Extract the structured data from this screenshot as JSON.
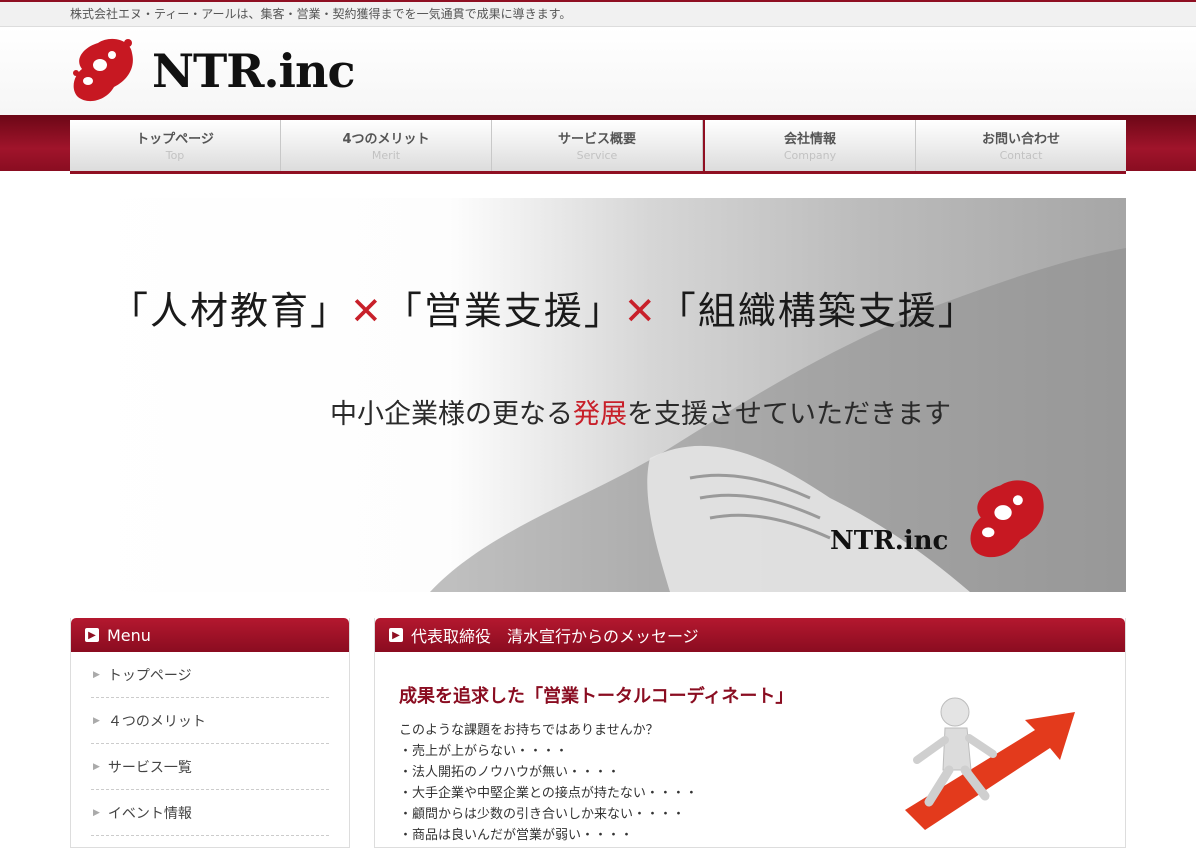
{
  "topbar": {
    "tagline": "株式会社エヌ・ティー・アールは、集客・営業・契約獲得までを一気通貫で成果に導きます。"
  },
  "header": {
    "logo_text": "NTR.inc",
    "logo_icon": "ntr-logo-mark"
  },
  "nav": [
    {
      "jp": "トップページ",
      "en": "Top"
    },
    {
      "jp": "4つのメリット",
      "en": "Merit"
    },
    {
      "jp": "サービス概要",
      "en": "Service"
    },
    {
      "jp": "会社情報",
      "en": "Company"
    },
    {
      "jp": "お問い合わせ",
      "en": "Contact"
    }
  ],
  "hero": {
    "t1": "「人材教育」",
    "x": "✕",
    "t2": "「営業支援」",
    "t3": "「組織構築支援」",
    "sub_a": "中小企業様の更なる",
    "sub_hl": "発展",
    "sub_b": "を支援させていただきます",
    "brand": "NTR.inc"
  },
  "sidebar": {
    "heading": "Menu",
    "items": [
      "トップページ",
      "４つのメリット",
      "サービス一覧",
      "イベント情報"
    ]
  },
  "main": {
    "heading": "代表取締役　清水宣行からのメッセージ",
    "title": "成果を追求した「営業トータルコーディネート」",
    "lines": [
      "このような課題をお持ちではありませんか？",
      "・売上が上がらない・・・・",
      "・法人開拓のノウハウが無い・・・・",
      "・大手企業や中堅企業との接点が持たない・・・・",
      "・顧問からは少数の引き合いしか来ない・・・・",
      "・商品は良いんだが営業が弱い・・・・"
    ]
  },
  "colors": {
    "brand_red": "#8f0f22",
    "accent_red": "#c8202a"
  }
}
